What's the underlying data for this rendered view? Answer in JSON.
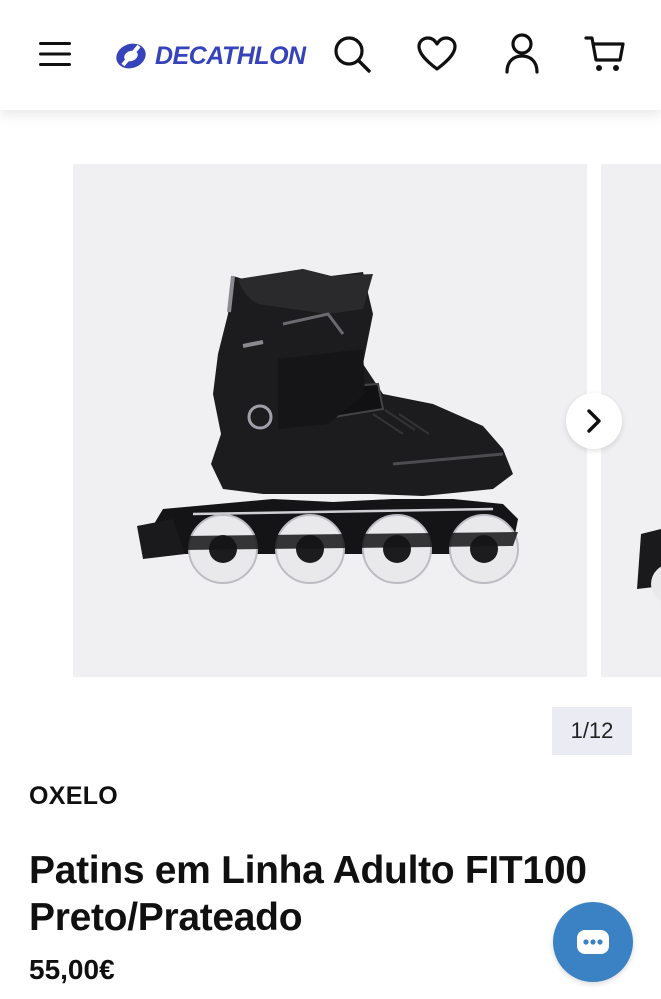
{
  "header": {
    "logo_text": "DECATHLON",
    "icons": [
      "menu-icon",
      "search-icon",
      "heart-icon",
      "account-icon",
      "cart-icon"
    ]
  },
  "gallery": {
    "current": 1,
    "total": 12,
    "counter_text": "1/12",
    "image_description_icon": "inline-skate-image"
  },
  "product": {
    "brand": "OXELO",
    "title": "Patins em Linha Adulto FIT100 Preto/Prateado",
    "price": "55,00€"
  },
  "colors": {
    "brand_blue": "#3643ba",
    "chat_blue": "#3b82c4",
    "image_bg": "#f0eff1",
    "counter_bg": "#ebebf3"
  }
}
